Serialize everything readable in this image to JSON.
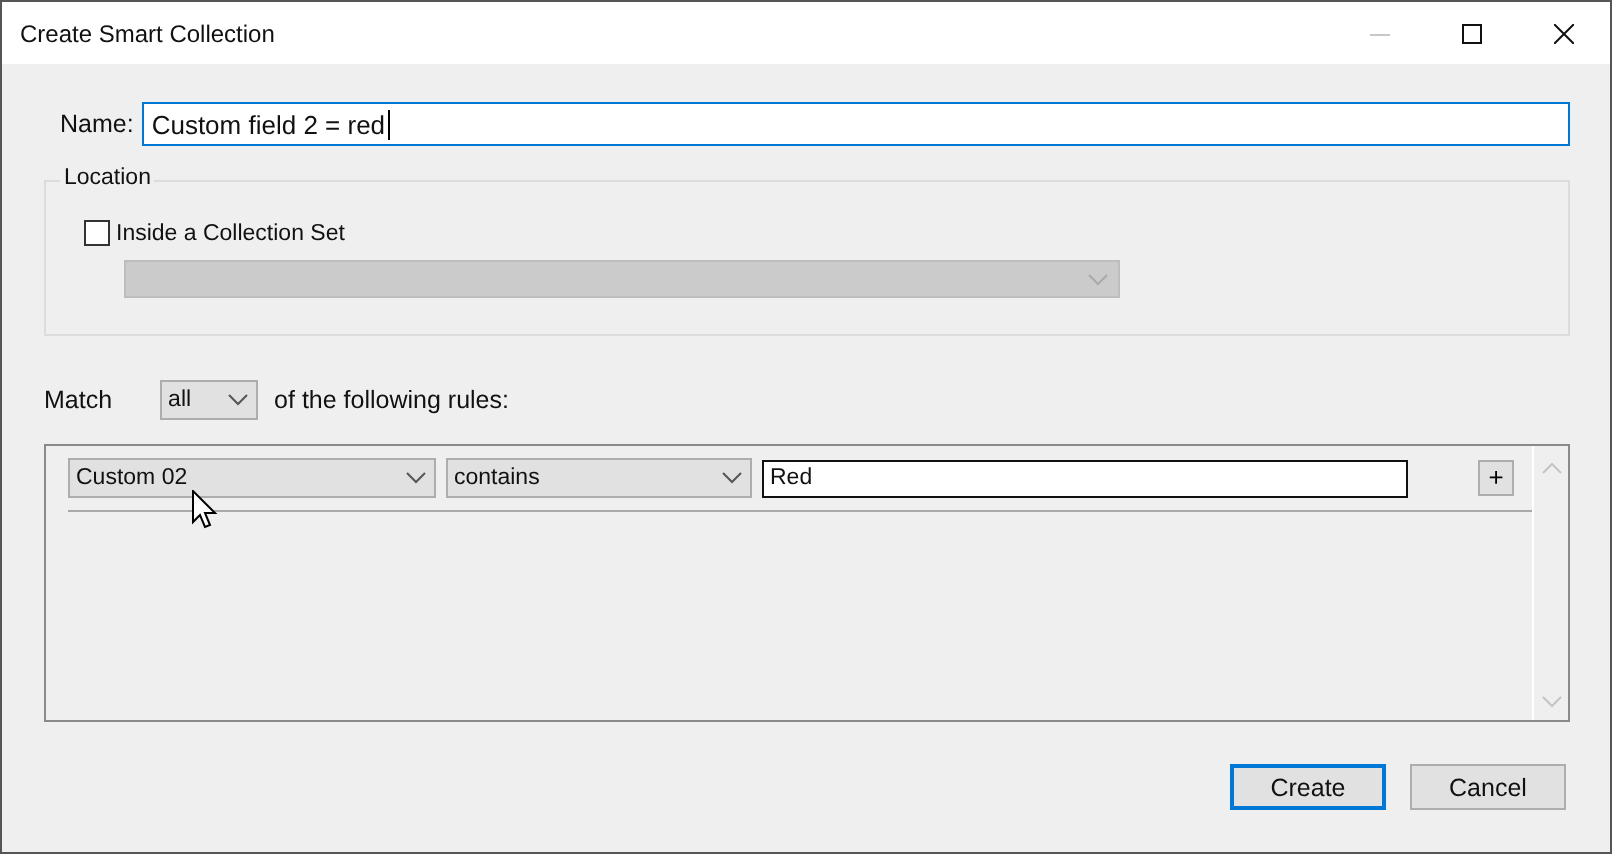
{
  "window": {
    "title": "Create Smart Collection",
    "controls": [
      {
        "kind": "minimize",
        "disabled": true
      },
      {
        "kind": "maximize",
        "disabled": false
      },
      {
        "kind": "close",
        "disabled": false
      }
    ]
  },
  "name_field": {
    "label": "Name:",
    "value": "Custom field 2 = red",
    "focused": true
  },
  "location": {
    "legend": "Location",
    "checkbox": {
      "label": "Inside a Collection Set",
      "checked": false
    },
    "collection_set_dropdown": {
      "disabled": true
    }
  },
  "match": {
    "label": "Match",
    "dropdown": "all",
    "suffix": "of the following rules:"
  },
  "rules": [
    {
      "field": "Custom 02",
      "operator": "contains",
      "value": "Red",
      "add_button": "+"
    }
  ],
  "buttons": [
    {
      "label": "Create",
      "default": true
    },
    {
      "label": "Cancel",
      "default": false
    }
  ]
}
